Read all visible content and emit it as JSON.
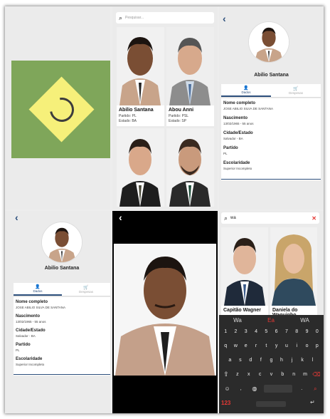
{
  "grid": {
    "search_placeholder": "Pesquisar...",
    "cards": [
      {
        "name": "Abilio Santana",
        "party": "Partido: PL",
        "state": "Estado: BA"
      },
      {
        "name": "Abou Anni",
        "party": "Partido: PSL",
        "state": "Estado: SP"
      },
      {
        "name": "",
        "party": "",
        "state": ""
      },
      {
        "name": "",
        "party": "",
        "state": ""
      }
    ]
  },
  "detail": {
    "name": "Abilio Santana",
    "tabs": [
      "Dados",
      "Despesas"
    ],
    "fields": [
      {
        "label": "Nome completo",
        "value": "JOSE ABILIO SILVA DE SANTANA"
      },
      {
        "label": "Nascimento",
        "value": "13/02/1965 - 55 anos"
      },
      {
        "label": "Cidade/Estado",
        "value": "Salvador - BA"
      },
      {
        "label": "Partido",
        "value": "PL"
      },
      {
        "label": "Escolaridade",
        "value": "Superior Incompleto"
      }
    ]
  },
  "search_result": {
    "query": "wa",
    "cards": [
      {
        "name": "Capitão Wagner"
      },
      {
        "name": "Daniela do Waguinho"
      }
    ]
  },
  "keyboard": {
    "suggestions": [
      "Wa",
      "Ea",
      "WA"
    ],
    "numbers": [
      "1",
      "2",
      "3",
      "4",
      "5",
      "6",
      "7",
      "8",
      "9",
      "0"
    ],
    "row1": [
      "q",
      "w",
      "e",
      "r",
      "t",
      "y",
      "u",
      "i",
      "o",
      "p"
    ],
    "row2": [
      "a",
      "s",
      "d",
      "f",
      "g",
      "h",
      "j",
      "k",
      "l"
    ],
    "row3": [
      "z",
      "x",
      "c",
      "v",
      "b",
      "n",
      "m"
    ],
    "mode_key": "123"
  },
  "colors": {
    "accent": "#2c4f7c",
    "flag_green": "#7fa65a",
    "flag_yellow": "#f6f07a",
    "error": "#e53935"
  }
}
